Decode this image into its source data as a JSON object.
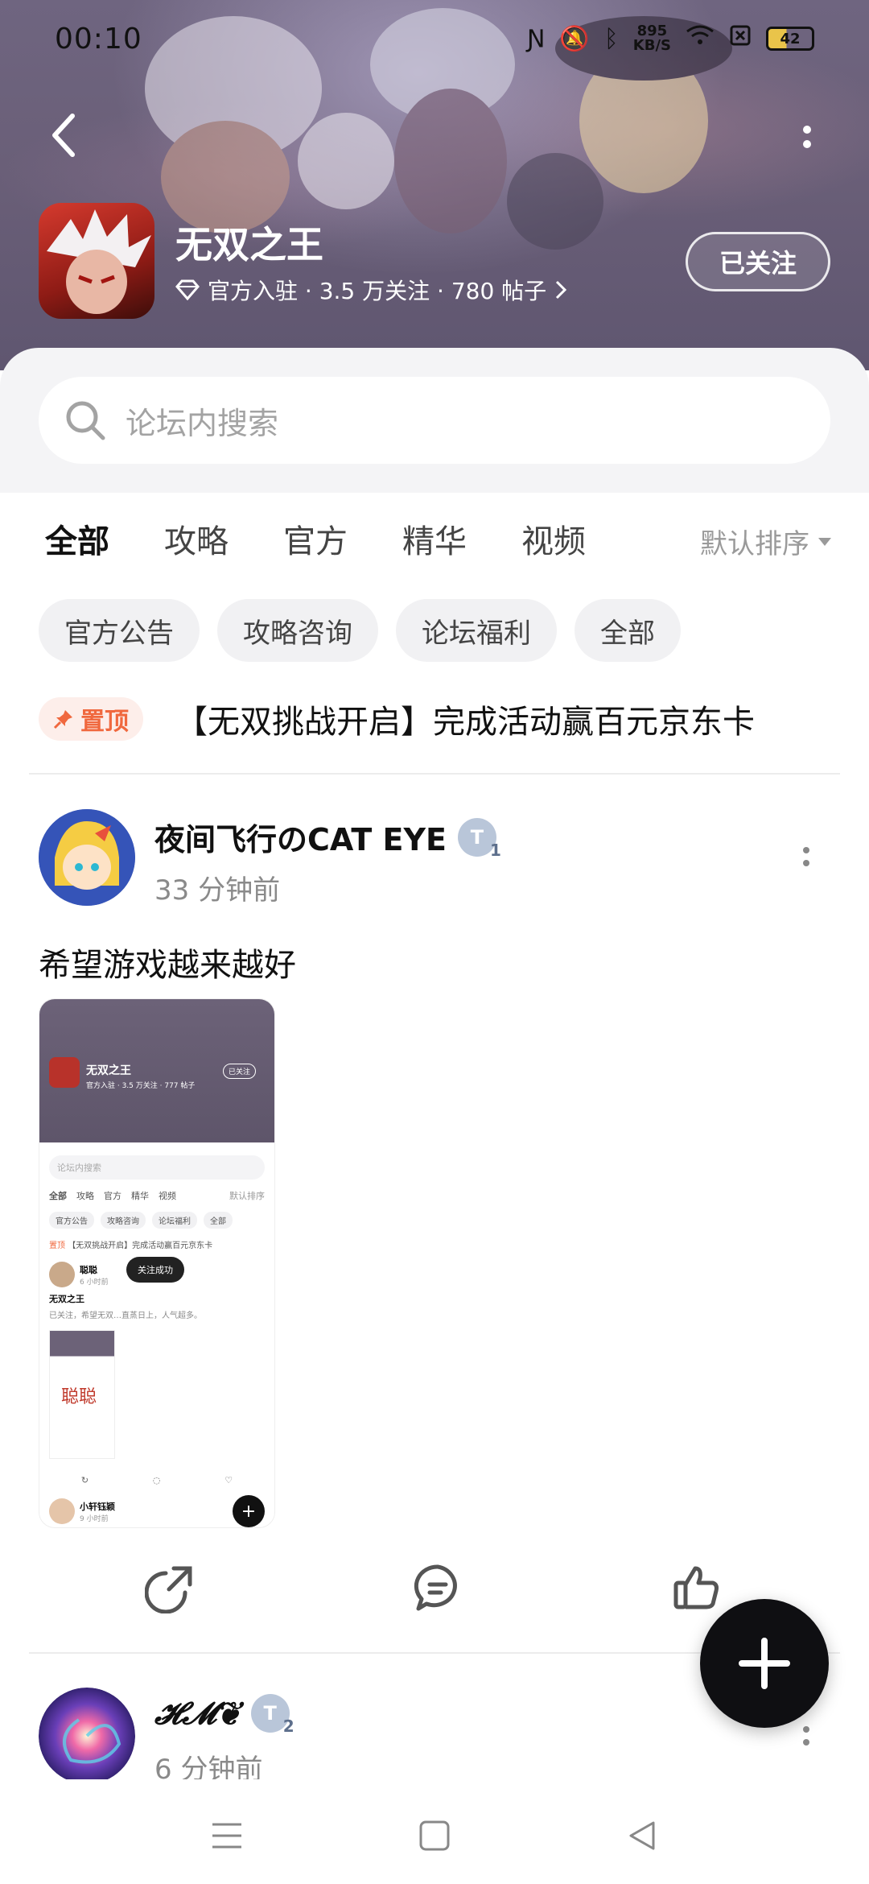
{
  "status_bar": {
    "time": "00:10",
    "net_speed_value": "895",
    "net_speed_unit": "KB/S",
    "battery": "42"
  },
  "app": {
    "name": "无双之王",
    "meta": "官方入驻 · 3.5 万关注 · 780 帖子",
    "follow_label": "已关注"
  },
  "search": {
    "placeholder": "论坛内搜索"
  },
  "tabs": [
    "全部",
    "攻略",
    "官方",
    "精华",
    "视频"
  ],
  "sort_label": "默认排序",
  "chips": [
    "官方公告",
    "攻略咨询",
    "论坛福利",
    "全部"
  ],
  "pinned": {
    "badge": "置顶",
    "title": "【无双挑战开启】完成活动赢百元京东卡"
  },
  "posts": [
    {
      "username": "夜间飞行のCAT EYE",
      "level": "1",
      "time": "33 分钟前",
      "text": "希望游戏越来越好"
    },
    {
      "username": "𝓗𝓜❦",
      "level": "2",
      "time": "6 分钟前"
    }
  ],
  "thumbnail": {
    "title": "无双之王",
    "meta": "官方入驻 · 3.5 万关注 · 777 帖子",
    "follow": "已关注",
    "search": "论坛内搜索",
    "tabs": [
      "全部",
      "攻略",
      "官方",
      "精华",
      "视频"
    ],
    "sort": "默认排序",
    "chips": [
      "官方公告",
      "攻略咨询",
      "论坛福利",
      "全部"
    ],
    "pinned_badge": "置顶",
    "pinned": "【无双挑战开启】完成活动赢百元京东卡",
    "user1": "聪聪",
    "user1_time": "6 小时前",
    "post_title": "无双之王",
    "post_excerpt": "已关注，希望无双…直蒸日上，人气超多。",
    "toast": "关注成功",
    "image_text": "聪聪",
    "user2": "小轩钰颖",
    "user2_time": "9 小时前"
  },
  "colors": {
    "accent": "#39cfc5",
    "pin": "#f0683e"
  },
  "icons": [
    "back-arrow-icon",
    "more-icon",
    "search-icon",
    "share-icon",
    "comment-icon",
    "like-icon",
    "add-icon",
    "menu-icon",
    "home-icon",
    "back-icon",
    "diamond-icon",
    "pin-icon"
  ]
}
